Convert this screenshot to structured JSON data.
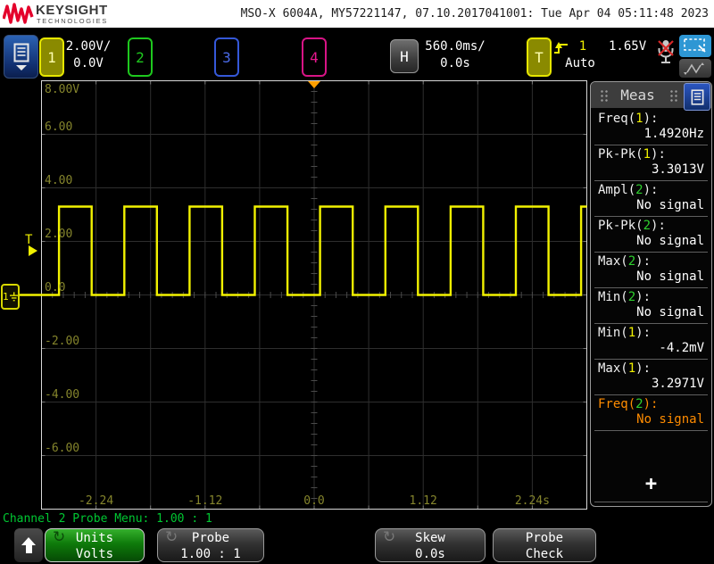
{
  "header": {
    "brand": "KEYSIGHT",
    "brand_sub": "TECHNOLOGIES",
    "title": "MSO-X 6004A, MY57221147, 07.10.2017041001: Tue Apr 04 05:11:48 2023"
  },
  "controls": {
    "channels": [
      {
        "label": "1",
        "active": true
      },
      {
        "label": "2",
        "active": false
      },
      {
        "label": "3",
        "active": false
      },
      {
        "label": "4",
        "active": false
      }
    ],
    "ch1_scale": "2.00V/",
    "ch1_offset": "0.0V",
    "horizontal": {
      "label": "H",
      "scale": "560.0ms/",
      "delay": "0.0s"
    },
    "trigger": {
      "label": "T",
      "source": "1",
      "mode": "Auto",
      "level": "1.65V"
    }
  },
  "icons": {
    "menu": "document-list",
    "trigger_slope": "rising-edge",
    "mic": "microphone-muted",
    "zoom_select": "dashed-rectangle-cursor",
    "pan": "triangle-wave-arrows",
    "refresh": "↻",
    "up": "arrow-up"
  },
  "plot": {
    "y_labels": [
      "8.00V",
      "6.00",
      "4.00",
      "2.00",
      "0.0",
      "-2.00",
      "-4.00",
      "-6.00"
    ],
    "x_labels": [
      "-2.24",
      "-1.12",
      "0.0",
      "1.12",
      "2.24s"
    ],
    "trigger_level_marker": "T",
    "ground_marker_ch": "1",
    "trace_color": "#f2f200",
    "grid_label_color": "#85852c"
  },
  "chart_data": {
    "type": "line",
    "title": "Channel 1 square wave",
    "x_range_s": [
      -2.8,
      2.8
    ],
    "y_range_v": [
      -8,
      8
    ],
    "volts_per_div": 2.0,
    "seconds_per_div": 0.56,
    "waveform": {
      "shape": "square",
      "high_v": 3.3,
      "low_v": 0.0,
      "period_s": 0.6702,
      "duty": 0.5,
      "first_rising_edge_s": -2.62,
      "frequency_hz": 1.492
    }
  },
  "sidebar": {
    "title": "Meas",
    "ch_colors": {
      "1": "#f0f000",
      "2": "#2ed02e"
    },
    "selected_color": "#ff8c00",
    "rows": [
      {
        "prefix": "Freq(",
        "ch": "1",
        "suffix": "):",
        "value": "1.4920Hz"
      },
      {
        "prefix": "Pk-Pk(",
        "ch": "1",
        "suffix": "):",
        "value": "3.3013V"
      },
      {
        "prefix": "Ampl(",
        "ch": "2",
        "suffix": "):",
        "value": "No signal"
      },
      {
        "prefix": "Pk-Pk(",
        "ch": "2",
        "suffix": "):",
        "value": "No signal"
      },
      {
        "prefix": "Max(",
        "ch": "2",
        "suffix": "):",
        "value": "No signal"
      },
      {
        "prefix": "Min(",
        "ch": "2",
        "suffix": "):",
        "value": "No signal"
      },
      {
        "prefix": "Min(",
        "ch": "1",
        "suffix": "):",
        "value": "-4.2mV"
      },
      {
        "prefix": "Max(",
        "ch": "1",
        "suffix": "):",
        "value": "3.2971V"
      },
      {
        "prefix": "Freq(",
        "ch": "2",
        "suffix": "):",
        "value": "No signal",
        "selected": true
      }
    ],
    "add_label": "+"
  },
  "footer": {
    "menu_title": "Channel 2 Probe Menu: 1.00 : 1",
    "buttons": [
      {
        "label": "Units",
        "value": "Volts",
        "style": "green",
        "refresh_icon": true
      },
      {
        "label": "Probe",
        "value": "1.00 : 1",
        "style": "dark",
        "refresh_icon": true
      },
      {
        "label": "Skew",
        "value": "0.0s",
        "style": "dark",
        "refresh_icon": true
      },
      {
        "label": "Probe",
        "value": "Check",
        "style": "dark",
        "refresh_icon": false
      }
    ]
  }
}
